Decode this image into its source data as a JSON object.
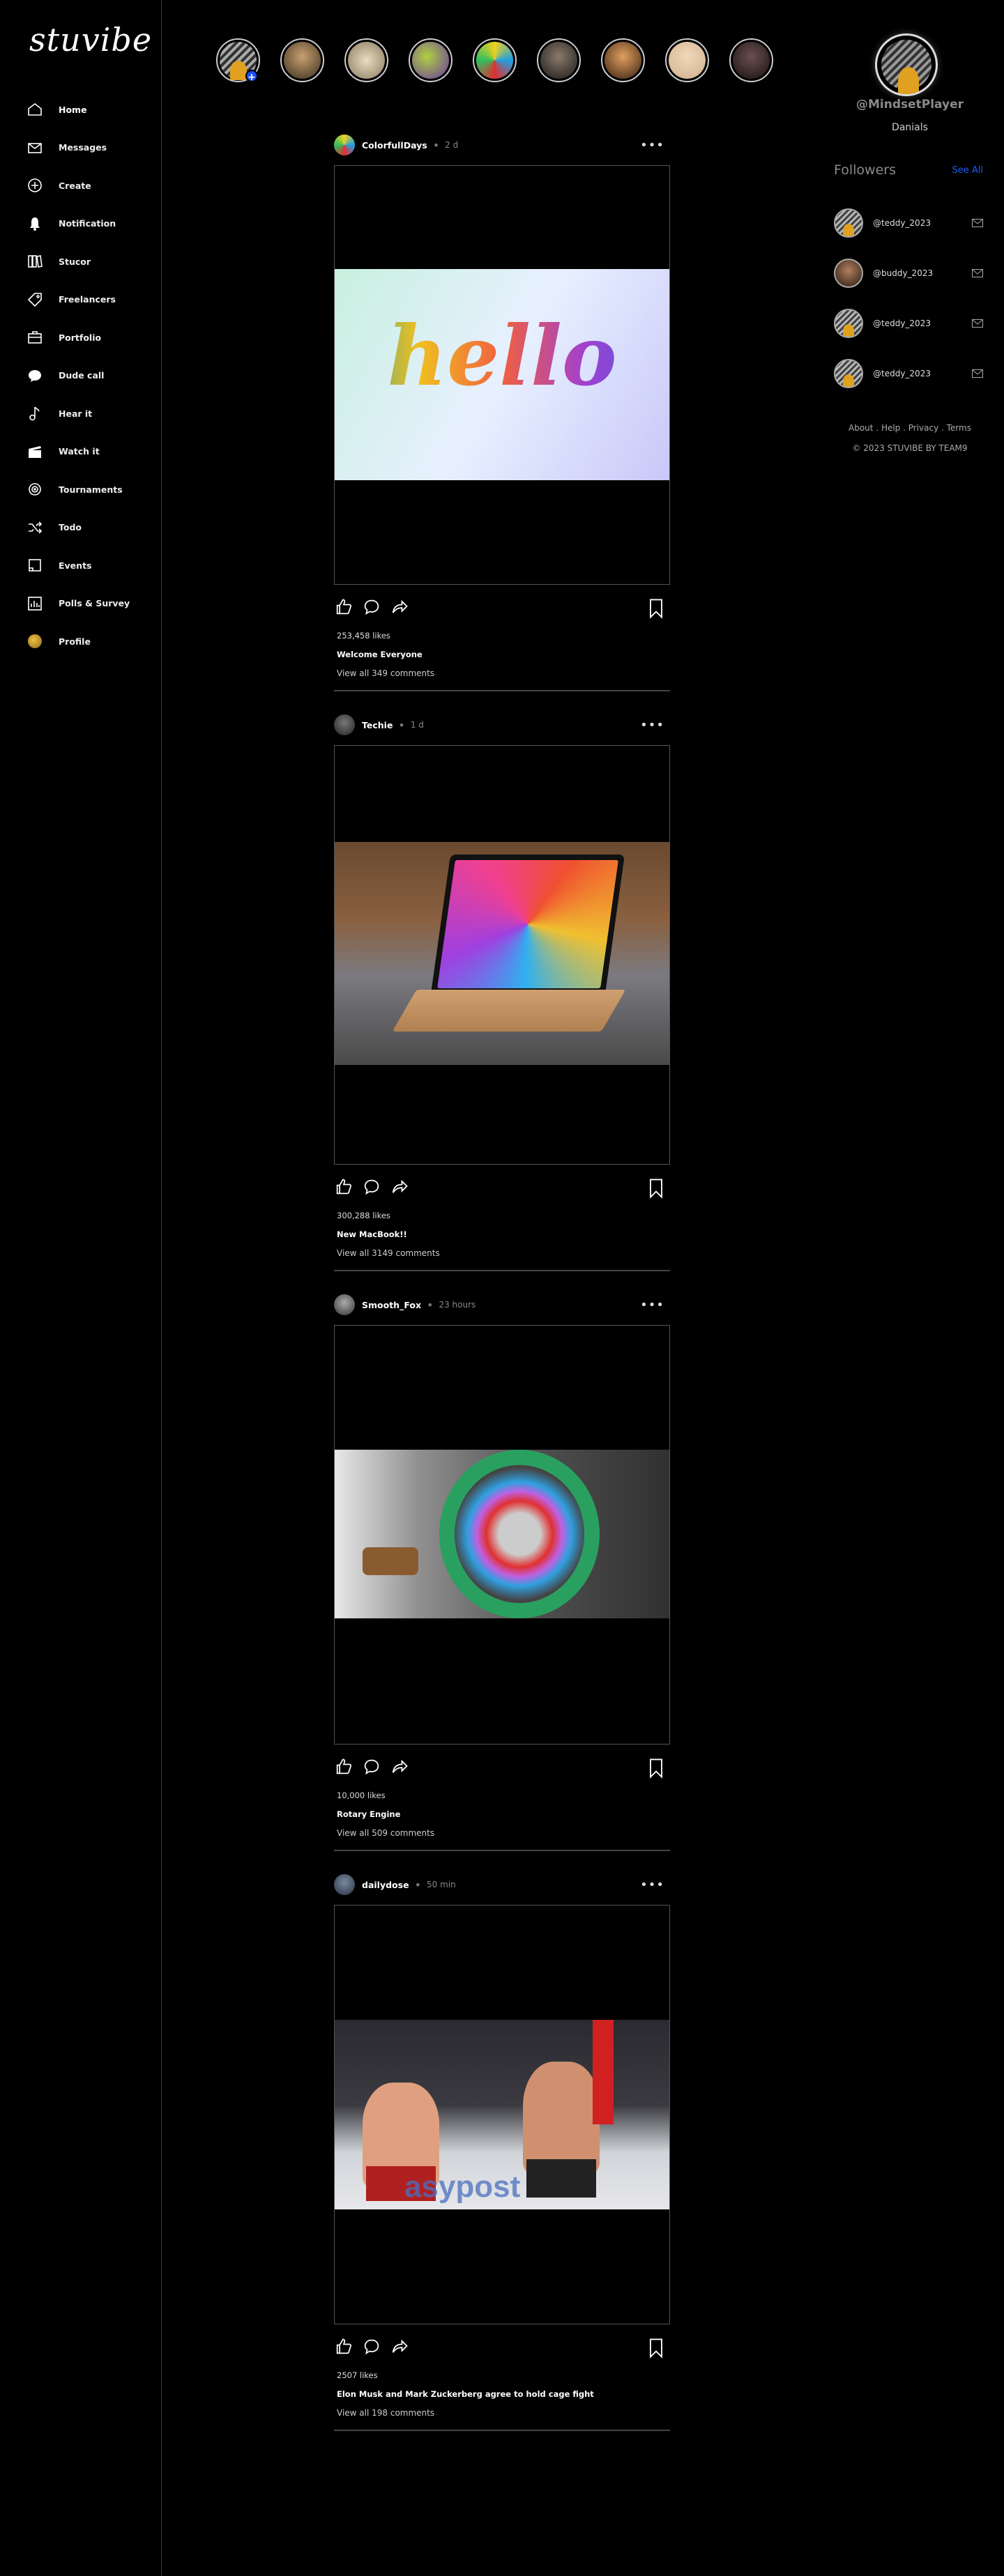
{
  "app": {
    "logo": "stuvibe"
  },
  "nav": [
    {
      "label": "Home",
      "icon": "home-icon"
    },
    {
      "label": "Messages",
      "icon": "mail-icon"
    },
    {
      "label": "Create",
      "icon": "plus-circle-icon"
    },
    {
      "label": "Notification",
      "icon": "bell-icon"
    },
    {
      "label": "Stucor",
      "icon": "books-icon"
    },
    {
      "label": "Freelancers",
      "icon": "tag-icon"
    },
    {
      "label": "Portfolio",
      "icon": "briefcase-icon"
    },
    {
      "label": "Dude call",
      "icon": "chat-bubble-icon"
    },
    {
      "label": "Hear it",
      "icon": "music-note-icon"
    },
    {
      "label": "Watch it",
      "icon": "clapperboard-icon"
    },
    {
      "label": "Tournaments",
      "icon": "target-icon"
    },
    {
      "label": "Todo",
      "icon": "shuffle-icon"
    },
    {
      "label": "Events",
      "icon": "calendar-icon"
    },
    {
      "label": "Polls & Survey",
      "icon": "poll-icon"
    },
    {
      "label": "Profile",
      "icon": "avatar-icon"
    }
  ],
  "stories": {
    "add_label": "+",
    "items": [
      {
        "color": "#d8a42a"
      },
      {
        "color": "#6b5a3c"
      },
      {
        "color": "#b8a68a"
      },
      {
        "color": "#7a5ab0"
      },
      {
        "color": "#2a9fd6"
      },
      {
        "color": "#3a3a3a"
      },
      {
        "color": "#8c5a2a"
      },
      {
        "color": "#e6c8a8"
      },
      {
        "color": "#4a3a3a"
      }
    ]
  },
  "profile": {
    "username": "@MindsetPlayer",
    "name": "Danials"
  },
  "followers": {
    "title": "Followers",
    "see_all": "See All",
    "items": [
      {
        "handle": "@teddy_2023",
        "color": "#c9a040"
      },
      {
        "handle": "@buddy_2023",
        "color": "#6a4a3a"
      },
      {
        "handle": "@teddy_2023",
        "color": "#c9a040"
      },
      {
        "handle": "@teddy_2023",
        "color": "#c9a040"
      }
    ]
  },
  "footer": {
    "links": "About . Help . Privacy . Terms",
    "copyright": "© 2023 STUVIBE BY TEAM9"
  },
  "posts": [
    {
      "user": "ColorfullDays",
      "time": "2 d",
      "likes": "253,458 likes",
      "caption": "Welcome Everyone",
      "comments": "View all 349 comments",
      "image_text": "hello"
    },
    {
      "user": "Techie",
      "time": "1 d",
      "likes": "300,288 likes",
      "caption": "New MacBook!!",
      "comments": "View all 3149 comments"
    },
    {
      "user": "Smooth_Fox",
      "time": "23 hours",
      "likes": "10,000 likes",
      "caption": "Rotary Engine",
      "comments": "View all 509 comments"
    },
    {
      "user": "dailydose",
      "time": "50 min",
      "likes": "2507 likes",
      "caption": "Elon Musk and Mark Zuckerberg agree to hold cage fight",
      "comments": "View all 198 comments",
      "image_text": "asypost"
    }
  ]
}
